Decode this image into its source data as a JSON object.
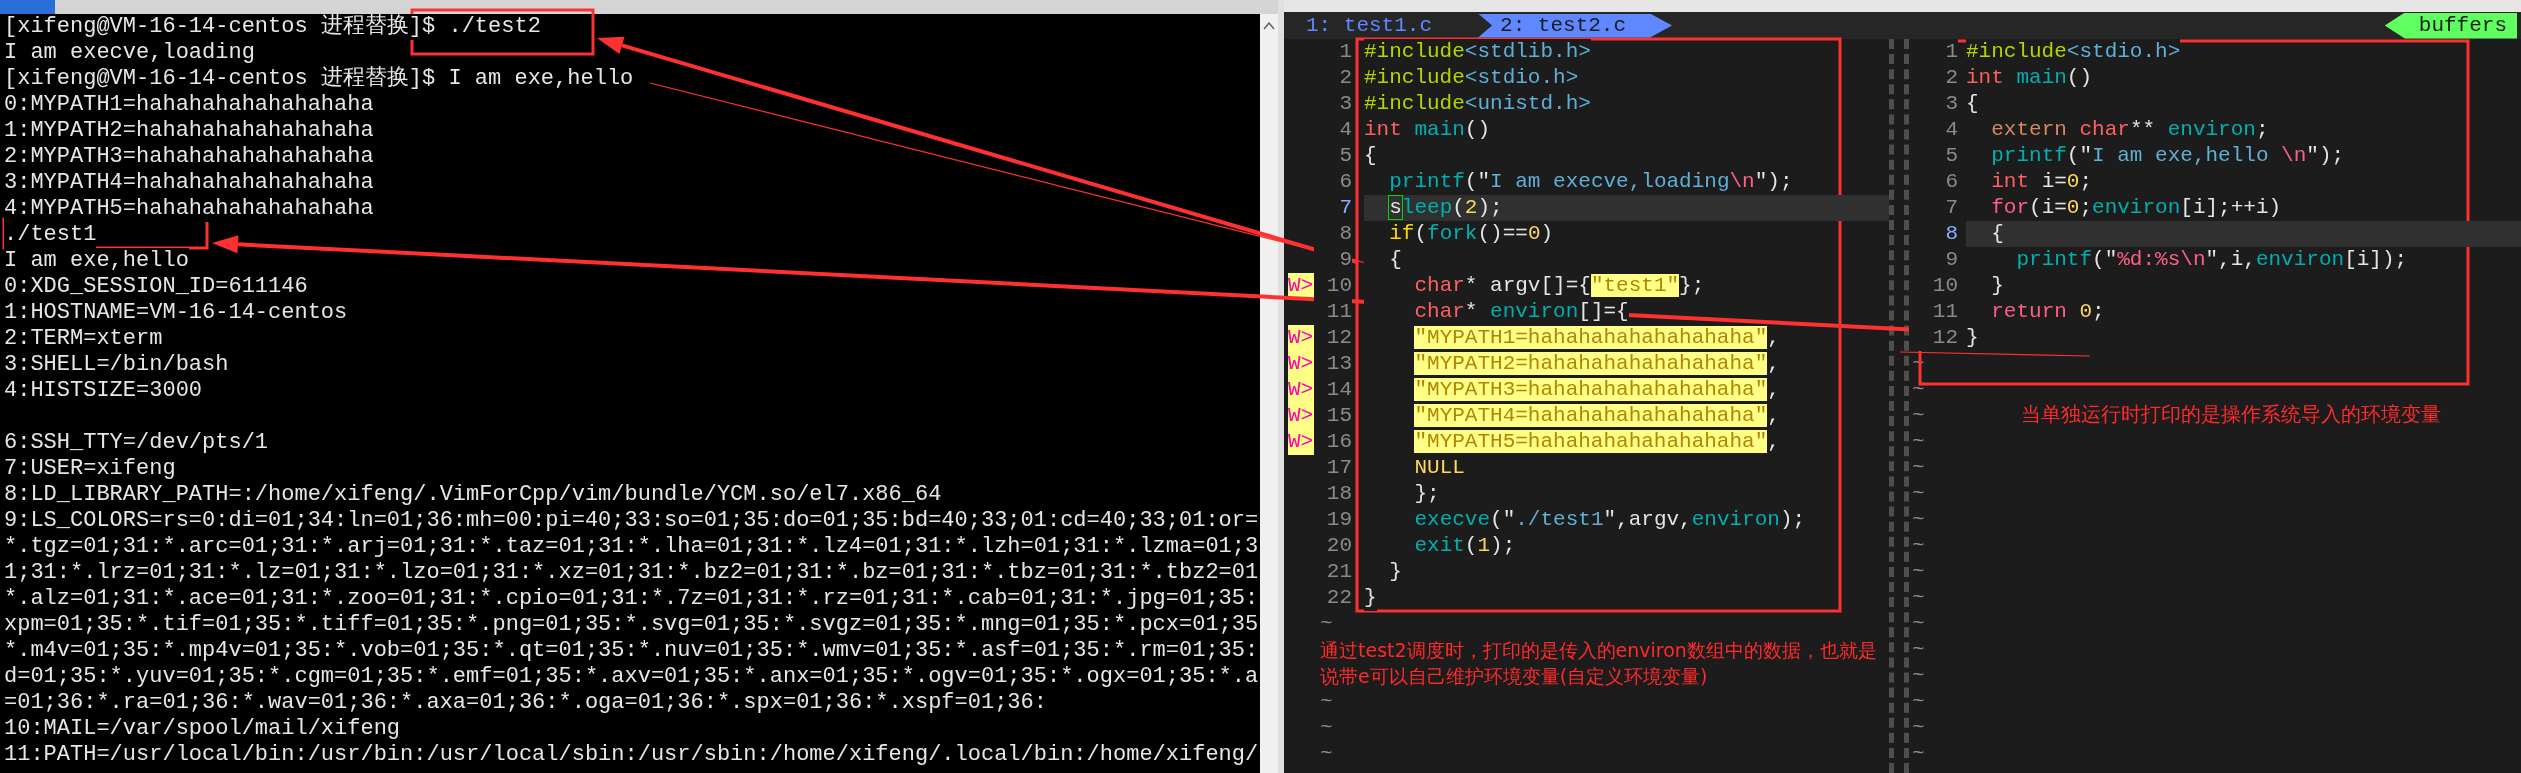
{
  "terminal": {
    "lines": [
      {
        "kind": "text",
        "text": "[xifeng@VM-16-14-centos 进程替换]$ ./test2"
      },
      {
        "kind": "text",
        "text": "I am execve,loading"
      },
      {
        "kind": "text",
        "text": "[xifeng@VM-16-14-centos 进程替换]$ I am exe,hello"
      },
      {
        "kind": "text",
        "text": "0:MYPATH1=hahahahahahahahaha"
      },
      {
        "kind": "text",
        "text": "1:MYPATH2=hahahahahahahahaha"
      },
      {
        "kind": "text",
        "text": "2:MYPATH3=hahahahahahahahaha"
      },
      {
        "kind": "text",
        "text": "3:MYPATH4=hahahahahahahahaha"
      },
      {
        "kind": "text",
        "text": "4:MYPATH5=hahahahahahahahaha"
      },
      {
        "kind": "text",
        "text": "./test1"
      },
      {
        "kind": "text",
        "text": "I am exe,hello"
      },
      {
        "kind": "text",
        "text": "0:XDG_SESSION_ID=611146"
      },
      {
        "kind": "text",
        "text": "1:HOSTNAME=VM-16-14-centos"
      },
      {
        "kind": "text",
        "text": "2:TERM=xterm"
      },
      {
        "kind": "text",
        "text": "3:SHELL=/bin/bash"
      },
      {
        "kind": "text",
        "text": "4:HISTSIZE=3000"
      },
      {
        "kind": "blank"
      },
      {
        "kind": "text",
        "text": "6:SSH_TTY=/dev/pts/1"
      },
      {
        "kind": "text",
        "text": "7:USER=xifeng"
      },
      {
        "kind": "text",
        "text": "8:LD_LIBRARY_PATH=:/home/xifeng/.VimForCpp/vim/bundle/YCM.so/el7.x86_64"
      },
      {
        "kind": "text",
        "text": "9:LS_COLORS=rs=0:di=01;34:ln=01;36:mh=00:pi=40;33:so=01;35:do=01;35:bd=40;33;01:cd=40;33;01:or="
      },
      {
        "kind": "text",
        "text": "*.tgz=01;31:*.arc=01;31:*.arj=01;31:*.taz=01;31:*.lha=01;31:*.lz4=01;31:*.lzh=01;31:*.lzma=01;3"
      },
      {
        "kind": "text",
        "text": "1;31:*.lrz=01;31:*.lz=01;31:*.lzo=01;31:*.xz=01;31:*.bz2=01;31:*.bz=01;31:*.tbz=01;31:*.tbz2=01"
      },
      {
        "kind": "text",
        "text": "*.alz=01;31:*.ace=01;31:*.zoo=01;31:*.cpio=01;31:*.7z=01;31:*.rz=01;31:*.cab=01;31:*.jpg=01;35:"
      },
      {
        "kind": "text",
        "text": "xpm=01;35:*.tif=01;35:*.tiff=01;35:*.png=01;35:*.svg=01;35:*.svgz=01;35:*.mng=01;35:*.pcx=01;35"
      },
      {
        "kind": "text",
        "text": "*.m4v=01;35:*.mp4v=01;35:*.vob=01;35:*.qt=01;35:*.nuv=01;35:*.wmv=01;35:*.asf=01;35:*.rm=01;35:"
      },
      {
        "kind": "text",
        "text": "d=01;35:*.yuv=01;35:*.cgm=01;35:*.emf=01;35:*.axv=01;35:*.anx=01;35:*.ogv=01;35:*.ogx=01;35:*.a"
      },
      {
        "kind": "text",
        "text": "=01;36:*.ra=01;36:*.wav=01;36:*.axa=01;36:*.oga=01;36:*.spx=01;36:*.xspf=01;36:"
      },
      {
        "kind": "text",
        "text": "10:MAIL=/var/spool/mail/xifeng"
      },
      {
        "kind": "text",
        "text": "11:PATH=/usr/local/bin:/usr/bin:/usr/local/sbin:/usr/sbin:/home/xifeng/.local/bin:/home/xifeng/"
      }
    ]
  },
  "editor": {
    "tabs": [
      {
        "label": "1: test1.c",
        "selected": false
      },
      {
        "label": "2: test2.c",
        "selected": true
      }
    ],
    "buffers_label": "buffers",
    "panes": [
      {
        "lines": [
          {
            "number": "1",
            "current": false,
            "tokens": [
              {
                "kind": "pre",
                "text": "#include"
              },
              {
                "kind": "hdr",
                "text": "<stdlib.h>"
              }
            ]
          },
          {
            "number": "2",
            "current": false,
            "tokens": [
              {
                "kind": "pre",
                "text": "#include"
              },
              {
                "kind": "hdr",
                "text": "<stdio.h>"
              }
            ]
          },
          {
            "number": "3",
            "current": false,
            "tokens": [
              {
                "kind": "pre",
                "text": "#include"
              },
              {
                "kind": "hdr",
                "text": "<unistd.h>"
              }
            ]
          },
          {
            "number": "4",
            "current": false,
            "tokens": [
              {
                "kind": "type",
                "text": "int"
              },
              {
                "kind": "fn",
                "text": " main"
              },
              {
                "kind": "plain",
                "text": "()"
              }
            ]
          },
          {
            "number": "5",
            "current": false,
            "tokens": [
              {
                "kind": "plain",
                "text": "{"
              }
            ]
          },
          {
            "number": "6",
            "current": false,
            "tokens": [
              {
                "kind": "fn",
                "text": "  printf"
              },
              {
                "kind": "plain",
                "text": "(\""
              },
              {
                "kind": "str",
                "text": "I am execve,loading"
              },
              {
                "kind": "esc",
                "text": "\\n"
              },
              {
                "kind": "plain",
                "text": "\");"
              }
            ]
          },
          {
            "number": "7",
            "current": true,
            "tokens": [
              {
                "kind": "cursor",
                "text": "  s"
              },
              {
                "kind": "fn",
                "text": "leep"
              },
              {
                "kind": "plain",
                "text": "("
              },
              {
                "kind": "num",
                "text": "2"
              },
              {
                "kind": "plain",
                "text": ");"
              }
            ]
          },
          {
            "number": "8",
            "current": false,
            "tokens": [
              {
                "kind": "cond",
                "text": "  if"
              },
              {
                "kind": "plain",
                "text": "("
              },
              {
                "kind": "fn",
                "text": "fork"
              },
              {
                "kind": "plain",
                "text": "()=="
              },
              {
                "kind": "num",
                "text": "0"
              },
              {
                "kind": "plain",
                "text": ")"
              }
            ]
          },
          {
            "number": "9",
            "current": false,
            "tokens": [
              {
                "kind": "plain",
                "text": "  {"
              }
            ]
          },
          {
            "number": "10",
            "sign": "W>",
            "current": false,
            "tokens": [
              {
                "kind": "type",
                "text": "    char"
              },
              {
                "kind": "plain",
                "text": "* argv[]={"
              },
              {
                "kind": "hstr",
                "text": "\"test1\""
              },
              {
                "kind": "plain",
                "text": "};"
              }
            ]
          },
          {
            "number": "11",
            "current": false,
            "tokens": [
              {
                "kind": "type",
                "text": "    char"
              },
              {
                "kind": "plain",
                "text": "* "
              },
              {
                "kind": "fn",
                "text": "environ"
              },
              {
                "kind": "plain",
                "text": "[]={"
              }
            ]
          },
          {
            "number": "12",
            "sign": "W>",
            "current": false,
            "tokens": [
              {
                "kind": "hstr",
                "text": "    \"MYPATH1=hahahahahahahahaha\""
              },
              {
                "kind": "plain",
                "text": ","
              }
            ]
          },
          {
            "number": "13",
            "sign": "W>",
            "current": false,
            "tokens": [
              {
                "kind": "hstr",
                "text": "    \"MYPATH2=hahahahahahahahaha\""
              },
              {
                "kind": "plain",
                "text": ","
              }
            ]
          },
          {
            "number": "14",
            "sign": "W>",
            "current": false,
            "tokens": [
              {
                "kind": "hstr",
                "text": "    \"MYPATH3=hahahahahahahahaha\""
              },
              {
                "kind": "plain",
                "text": ","
              }
            ]
          },
          {
            "number": "15",
            "sign": "W>",
            "current": false,
            "tokens": [
              {
                "kind": "hstr",
                "text": "    \"MYPATH4=hahahahahahahahaha\""
              },
              {
                "kind": "plain",
                "text": ","
              }
            ]
          },
          {
            "number": "16",
            "sign": "W>",
            "current": false,
            "tokens": [
              {
                "kind": "hstr",
                "text": "    \"MYPATH5=hahahahahahahahaha\""
              },
              {
                "kind": "plain",
                "text": ","
              }
            ]
          },
          {
            "number": "17",
            "current": false,
            "tokens": [
              {
                "kind": "num",
                "text": "    NULL"
              }
            ]
          },
          {
            "number": "18",
            "current": false,
            "tokens": [
              {
                "kind": "plain",
                "text": "    };"
              }
            ]
          },
          {
            "number": "19",
            "current": false,
            "tokens": [
              {
                "kind": "fn",
                "text": "    execve"
              },
              {
                "kind": "plain",
                "text": "(\""
              },
              {
                "kind": "str",
                "text": "./test1"
              },
              {
                "kind": "plain",
                "text": "\",argv,"
              },
              {
                "kind": "fn",
                "text": "environ"
              },
              {
                "kind": "plain",
                "text": ");"
              }
            ]
          },
          {
            "number": "20",
            "current": false,
            "tokens": [
              {
                "kind": "fn",
                "text": "    exit"
              },
              {
                "kind": "plain",
                "text": "("
              },
              {
                "kind": "num",
                "text": "1"
              },
              {
                "kind": "plain",
                "text": ");"
              }
            ]
          },
          {
            "number": "21",
            "current": false,
            "tokens": [
              {
                "kind": "plain",
                "text": "  }"
              }
            ]
          },
          {
            "number": "22",
            "current": false,
            "tokens": [
              {
                "kind": "plain",
                "text": "}"
              }
            ]
          }
        ],
        "below": [
          {
            "kind": "tilde",
            "text": "~"
          },
          {
            "kind": "note",
            "text": "通过test2调度时，打印的是传入的environ数组中的数据，也就是说带e可以自己维护环境变量(自定义环境变量)"
          },
          {
            "kind": "tilde",
            "text": "~"
          },
          {
            "kind": "tilde",
            "text": "~"
          },
          {
            "kind": "tilde",
            "text": "~"
          }
        ]
      },
      {
        "lines": [
          {
            "number": "1",
            "current": false,
            "tokens": [
              {
                "kind": "pre",
                "text": "#include"
              },
              {
                "kind": "hdr",
                "text": "<stdio.h>"
              }
            ]
          },
          {
            "number": "2",
            "current": false,
            "tokens": [
              {
                "kind": "type",
                "text": "int"
              },
              {
                "kind": "fn",
                "text": " main"
              },
              {
                "kind": "plain",
                "text": "()"
              }
            ]
          },
          {
            "number": "3",
            "current": false,
            "tokens": [
              {
                "kind": "plain",
                "text": "{"
              }
            ]
          },
          {
            "number": "4",
            "current": false,
            "tokens": [
              {
                "kind": "storage",
                "text": "  extern"
              },
              {
                "kind": "type",
                "text": " char"
              },
              {
                "kind": "plain",
                "text": "** "
              },
              {
                "kind": "fn",
                "text": "environ"
              },
              {
                "kind": "plain",
                "text": ";"
              }
            ]
          },
          {
            "number": "5",
            "current": false,
            "tokens": [
              {
                "kind": "fn",
                "text": "  printf"
              },
              {
                "kind": "plain",
                "text": "(\""
              },
              {
                "kind": "str",
                "text": "I am exe,hello "
              },
              {
                "kind": "esc",
                "text": "\\n"
              },
              {
                "kind": "plain",
                "text": "\");"
              }
            ]
          },
          {
            "number": "6",
            "current": false,
            "tokens": [
              {
                "kind": "type",
                "text": "  int"
              },
              {
                "kind": "plain",
                "text": " i="
              },
              {
                "kind": "num",
                "text": "0"
              },
              {
                "kind": "plain",
                "text": ";"
              }
            ]
          },
          {
            "number": "7",
            "current": false,
            "tokens": [
              {
                "kind": "kw",
                "text": "  for"
              },
              {
                "kind": "plain",
                "text": "(i="
              },
              {
                "kind": "num",
                "text": "0"
              },
              {
                "kind": "plain",
                "text": ";"
              },
              {
                "kind": "fn",
                "text": "environ"
              },
              {
                "kind": "plain",
                "text": "[i];++i)"
              }
            ]
          },
          {
            "number": "8",
            "current": true,
            "tokens": [
              {
                "kind": "plain",
                "text": "  {"
              }
            ]
          },
          {
            "number": "9",
            "current": false,
            "tokens": [
              {
                "kind": "fn",
                "text": "    printf"
              },
              {
                "kind": "plain",
                "text": "(\""
              },
              {
                "kind": "esc",
                "text": "%d:%s\\n"
              },
              {
                "kind": "plain",
                "text": "\",i,"
              },
              {
                "kind": "fn",
                "text": "environ"
              },
              {
                "kind": "plain",
                "text": "[i]);"
              }
            ]
          },
          {
            "number": "10",
            "current": false,
            "tokens": [
              {
                "kind": "plain",
                "text": "  }"
              }
            ]
          },
          {
            "number": "11",
            "current": false,
            "tokens": [
              {
                "kind": "kw",
                "text": "  return"
              },
              {
                "kind": "num",
                "text": " 0"
              },
              {
                "kind": "plain",
                "text": ";"
              }
            ]
          },
          {
            "number": "12",
            "current": false,
            "tokens": [
              {
                "kind": "plain",
                "text": "}"
              }
            ]
          }
        ],
        "below": [
          {
            "kind": "tilde",
            "text": "~"
          },
          {
            "kind": "tilde",
            "text": "~"
          },
          {
            "kind": "tilde",
            "text": "~",
            "note": "当单独运行时打印的是操作系统导入的环境变量"
          },
          {
            "kind": "tilde",
            "text": "~"
          },
          {
            "kind": "tilde",
            "text": "~"
          },
          {
            "kind": "tilde",
            "text": "~"
          },
          {
            "kind": "tilde",
            "text": "~"
          },
          {
            "kind": "tilde",
            "text": "~"
          },
          {
            "kind": "tilde",
            "text": "~"
          },
          {
            "kind": "tilde",
            "text": "~"
          },
          {
            "kind": "tilde",
            "text": "~"
          },
          {
            "kind": "tilde",
            "text": "~"
          },
          {
            "kind": "tilde",
            "text": "~"
          },
          {
            "kind": "tilde",
            "text": "~"
          },
          {
            "kind": "tilde",
            "text": "~"
          },
          {
            "kind": "tilde",
            "text": "~"
          }
        ]
      }
    ]
  }
}
